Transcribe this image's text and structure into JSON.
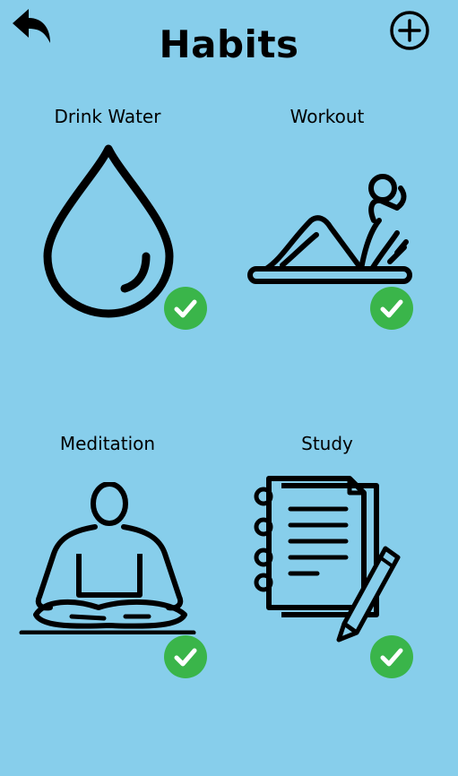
{
  "header": {
    "title": "Habits",
    "back_icon": "undo-arrow-icon",
    "add_icon": "plus-circle-icon"
  },
  "habits": [
    {
      "label": "Drink Water",
      "icon": "water-drop-icon",
      "completed": true
    },
    {
      "label": "Workout",
      "icon": "situp-exercise-icon",
      "completed": true
    },
    {
      "label": "Meditation",
      "icon": "meditation-pose-icon",
      "completed": true
    },
    {
      "label": "Study",
      "icon": "notebook-pencil-icon",
      "completed": true
    }
  ],
  "colors": {
    "background": "#87ceeb",
    "check": "#3ab54a",
    "ink": "#000000"
  }
}
